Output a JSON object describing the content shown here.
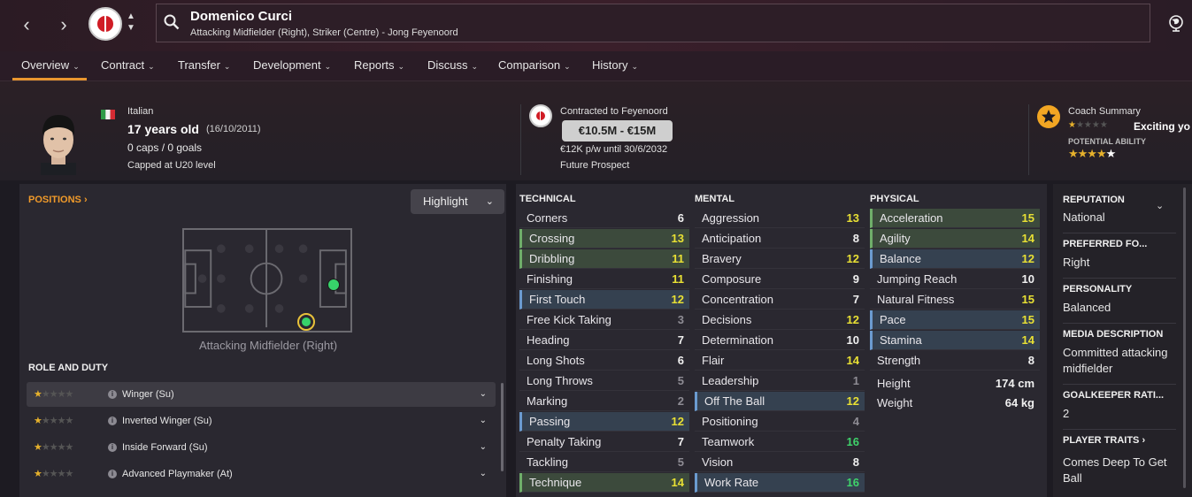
{
  "window": {
    "back": "‹",
    "forward": "›"
  },
  "player": {
    "name": "Domenico Curci",
    "subtitle": "Attacking Midfielder (Right), Striker (Centre) - Jong Feyenoord",
    "nationality": "Italian",
    "age": "17 years old",
    "dob": "(16/10/2011)",
    "caps": "0 caps / 0 goals",
    "capped": "Capped at U20 level"
  },
  "tabs": [
    "Overview",
    "Contract",
    "Transfer",
    "Development",
    "Reports",
    "Discuss",
    "Comparison",
    "History"
  ],
  "contract": {
    "club": "Contracted to Feyenoord",
    "value": "€10.5M - €15M",
    "wage": "€12K p/w until 30/6/2032",
    "status": "Future Prospect"
  },
  "coach": {
    "title": "Coach Summary",
    "summary": "Exciting yo",
    "potential_label": "POTENTIAL ABILITY",
    "current_stars": 1.5,
    "potential_stars": 4.5
  },
  "positions": {
    "title": "POSITIONS ›",
    "highlight": "Highlight",
    "pitch_label": "Attacking Midfielder (Right)"
  },
  "roles": {
    "title": "ROLE AND DUTY",
    "items": [
      {
        "name": "Winger (Su)",
        "stars": 1.5
      },
      {
        "name": "Inverted Winger (Su)",
        "stars": 1.5
      },
      {
        "name": "Inside Forward (Su)",
        "stars": 1.5
      },
      {
        "name": "Advanced Playmaker (At)",
        "stars": 1.5
      }
    ]
  },
  "attributes": {
    "technical_title": "TECHNICAL",
    "mental_title": "MENTAL",
    "physical_title": "PHYSICAL",
    "technical": [
      {
        "n": "Corners",
        "v": "6",
        "h": ""
      },
      {
        "n": "Crossing",
        "v": "13",
        "h": "g"
      },
      {
        "n": "Dribbling",
        "v": "11",
        "h": "g"
      },
      {
        "n": "Finishing",
        "v": "11",
        "h": ""
      },
      {
        "n": "First Touch",
        "v": "12",
        "h": "b"
      },
      {
        "n": "Free Kick Taking",
        "v": "3",
        "h": ""
      },
      {
        "n": "Heading",
        "v": "7",
        "h": ""
      },
      {
        "n": "Long Shots",
        "v": "6",
        "h": ""
      },
      {
        "n": "Long Throws",
        "v": "5",
        "h": ""
      },
      {
        "n": "Marking",
        "v": "2",
        "h": ""
      },
      {
        "n": "Passing",
        "v": "12",
        "h": "b"
      },
      {
        "n": "Penalty Taking",
        "v": "7",
        "h": ""
      },
      {
        "n": "Tackling",
        "v": "5",
        "h": ""
      },
      {
        "n": "Technique",
        "v": "14",
        "h": "g"
      }
    ],
    "mental": [
      {
        "n": "Aggression",
        "v": "13",
        "h": ""
      },
      {
        "n": "Anticipation",
        "v": "8",
        "h": ""
      },
      {
        "n": "Bravery",
        "v": "12",
        "h": ""
      },
      {
        "n": "Composure",
        "v": "9",
        "h": ""
      },
      {
        "n": "Concentration",
        "v": "7",
        "h": ""
      },
      {
        "n": "Decisions",
        "v": "12",
        "h": ""
      },
      {
        "n": "Determination",
        "v": "10",
        "h": ""
      },
      {
        "n": "Flair",
        "v": "14",
        "h": ""
      },
      {
        "n": "Leadership",
        "v": "1",
        "h": ""
      },
      {
        "n": "Off The Ball",
        "v": "12",
        "h": "b"
      },
      {
        "n": "Positioning",
        "v": "4",
        "h": ""
      },
      {
        "n": "Teamwork",
        "v": "16",
        "h": ""
      },
      {
        "n": "Vision",
        "v": "8",
        "h": ""
      },
      {
        "n": "Work Rate",
        "v": "16",
        "h": "b"
      }
    ],
    "physical": [
      {
        "n": "Acceleration",
        "v": "15",
        "h": "g"
      },
      {
        "n": "Agility",
        "v": "14",
        "h": "g"
      },
      {
        "n": "Balance",
        "v": "12",
        "h": "b"
      },
      {
        "n": "Jumping Reach",
        "v": "10",
        "h": ""
      },
      {
        "n": "Natural Fitness",
        "v": "15",
        "h": ""
      },
      {
        "n": "Pace",
        "v": "15",
        "h": "b"
      },
      {
        "n": "Stamina",
        "v": "14",
        "h": "b"
      },
      {
        "n": "Strength",
        "v": "8",
        "h": ""
      }
    ],
    "height_label": "Height",
    "height": "174 cm",
    "weight_label": "Weight",
    "weight": "64 kg"
  },
  "info": {
    "reputation_label": "REPUTATION",
    "reputation": "National",
    "foot_label": "PREFERRED FO...",
    "foot": "Right",
    "personality_label": "PERSONALITY",
    "personality": "Balanced",
    "media_label": "MEDIA DESCRIPTION",
    "media": "Committed attacking midfielder",
    "gk_label": "GOALKEEPER RATI...",
    "gk": "2",
    "traits_label": "PLAYER TRAITS ›",
    "traits": "Comes Deep To Get Ball"
  },
  "colors": {
    "accent": "#e9962f",
    "green_value": "#3fd36b",
    "yellow_value": "#e8e034",
    "white_value": "#f0f0f0",
    "grey_value": "#8e8c94"
  }
}
